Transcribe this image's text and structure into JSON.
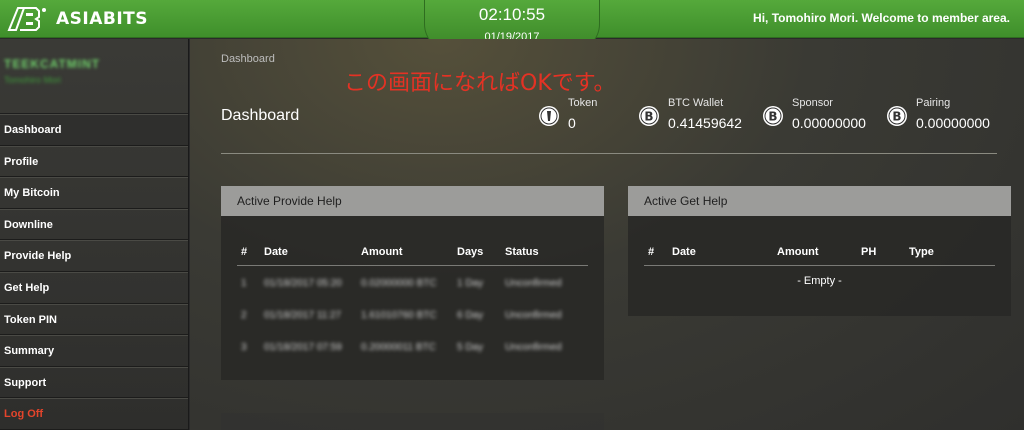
{
  "header": {
    "brand": "ASIABITS",
    "time": "02:10:55",
    "date": "01/19/2017",
    "welcome": "Hi, Tomohiro Mori. Welcome to member area.",
    "accent_color": "#4a9e34"
  },
  "sidebar": {
    "user_name": "TEEKCATMINT",
    "user_sub": "Tomohiro Mori",
    "items": [
      {
        "label": "Dashboard"
      },
      {
        "label": "Profile"
      },
      {
        "label": "My Bitcoin"
      },
      {
        "label": "Downline"
      },
      {
        "label": "Provide Help"
      },
      {
        "label": "Get Help"
      },
      {
        "label": "Token PIN"
      },
      {
        "label": "Summary"
      },
      {
        "label": "Support"
      },
      {
        "label": "Log Off"
      }
    ],
    "logoff_color": "#e4442b"
  },
  "main": {
    "breadcrumb": "Dashboard",
    "note": "この画面になればOKです。",
    "title": "Dashboard",
    "stats": [
      {
        "label": "Token",
        "value": "0",
        "icon": "token-icon"
      },
      {
        "label": "BTC Wallet",
        "value": "0.41459642",
        "icon": "bitcoin-icon"
      },
      {
        "label": "Sponsor",
        "value": "0.00000000",
        "icon": "bitcoin-icon"
      },
      {
        "label": "Pairing",
        "value": "0.00000000",
        "icon": "bitcoin-icon"
      }
    ],
    "provide_help": {
      "title": "Active Provide Help",
      "columns": [
        "#",
        "Date",
        "Amount",
        "Days",
        "Status"
      ],
      "rows": [
        [
          "1",
          "01/18/2017 05:20",
          "0.02000000 BTC",
          "1 Day",
          "Unconfirmed"
        ],
        [
          "2",
          "01/18/2017 11:27",
          "1.61010760 BTC",
          "6 Day",
          "Unconfirmed"
        ],
        [
          "3",
          "01/18/2017 07:59",
          "0.20000011 BTC",
          "5 Day",
          "Unconfirmed"
        ]
      ]
    },
    "get_help": {
      "title": "Active Get Help",
      "columns": [
        "#",
        "Date",
        "Amount",
        "PH",
        "Type"
      ],
      "empty": "- Empty -"
    }
  }
}
